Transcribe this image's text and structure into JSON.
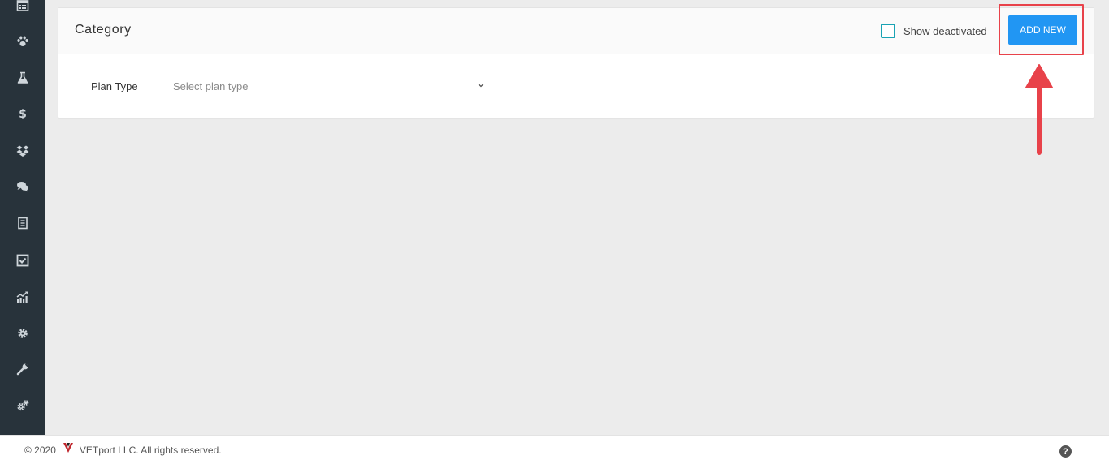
{
  "sidebar": {
    "items": [
      {
        "icon": "calendar-icon"
      },
      {
        "icon": "paw-icon"
      },
      {
        "icon": "flask-icon"
      },
      {
        "icon": "dollar-icon"
      },
      {
        "icon": "dropbox-icon"
      },
      {
        "icon": "chat-icon"
      },
      {
        "icon": "document-icon"
      },
      {
        "icon": "checkbox-icon"
      },
      {
        "icon": "chart-icon"
      },
      {
        "icon": "gear-icon"
      },
      {
        "icon": "wrench-icon"
      },
      {
        "icon": "gears-icon"
      }
    ]
  },
  "card": {
    "title": "Category",
    "show_deactivated_label": "Show deactivated",
    "show_deactivated_checked": false,
    "add_new_label": "ADD NEW",
    "plan_type_label": "Plan Type",
    "plan_type_placeholder": "Select plan type"
  },
  "footer": {
    "copyright_prefix": "© 2020",
    "copyright_text": "VETport LLC. All rights reserved.",
    "help_symbol": "?"
  },
  "colors": {
    "sidebar_bg": "#28333b",
    "button_blue": "#2196f3",
    "annotation_red": "#e8424a",
    "checkbox_teal": "#1aa3b4"
  }
}
